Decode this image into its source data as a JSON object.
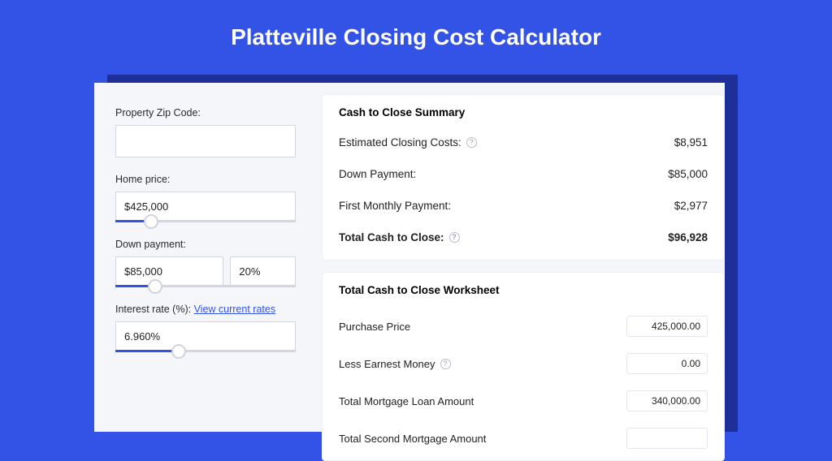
{
  "title": "Platteville Closing Cost Calculator",
  "sidebar": {
    "zip": {
      "label": "Property Zip Code:",
      "value": ""
    },
    "home_price": {
      "label": "Home price:",
      "value": "$425,000",
      "slider_pct": 20
    },
    "down_payment": {
      "label": "Down payment:",
      "value": "$85,000",
      "percent": "20%",
      "slider_pct": 22
    },
    "interest": {
      "label": "Interest rate (%): ",
      "link": "View current rates",
      "value": "6.960%",
      "slider_pct": 35
    }
  },
  "summary": {
    "title": "Cash to Close Summary",
    "rows": [
      {
        "label": "Estimated Closing Costs:",
        "help": true,
        "value": "$8,951",
        "bold": false
      },
      {
        "label": "Down Payment:",
        "help": false,
        "value": "$85,000",
        "bold": false
      },
      {
        "label": "First Monthly Payment:",
        "help": false,
        "value": "$2,977",
        "bold": false
      },
      {
        "label": "Total Cash to Close:",
        "help": true,
        "value": "$96,928",
        "bold": true
      }
    ]
  },
  "worksheet": {
    "title": "Total Cash to Close Worksheet",
    "rows": [
      {
        "label": "Purchase Price",
        "help": false,
        "value": "425,000.00"
      },
      {
        "label": "Less Earnest Money",
        "help": true,
        "value": "0.00"
      },
      {
        "label": "Total Mortgage Loan Amount",
        "help": false,
        "value": "340,000.00"
      },
      {
        "label": "Total Second Mortgage Amount",
        "help": false,
        "value": ""
      }
    ]
  }
}
